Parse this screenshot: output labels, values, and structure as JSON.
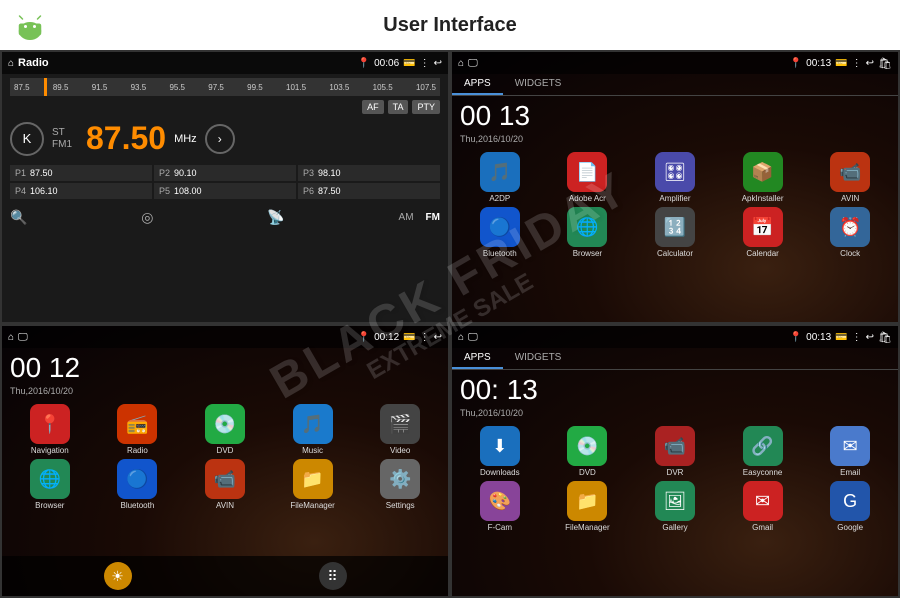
{
  "header": {
    "title": "User Interface"
  },
  "watermark": {
    "line1": "BLACK FRIDAY",
    "line2": "EXTREME SALE"
  },
  "screen1": {
    "title": "Radio",
    "status": {
      "time": "00:06",
      "icon_home": "⌂",
      "icon_map": "📍"
    },
    "freq_markers": [
      "87.5",
      "89.5",
      "91.5",
      "93.5",
      "95.5",
      "97.5",
      "99.5",
      "101.5",
      "103.5",
      "105.5",
      "107.5"
    ],
    "buttons": [
      "AF",
      "TA",
      "PTY"
    ],
    "band": "ST FM1",
    "frequency": "87.50",
    "unit": "MHz",
    "presets": [
      {
        "label": "P1",
        "freq": "87.50"
      },
      {
        "label": "P2",
        "freq": "90.10"
      },
      {
        "label": "P3",
        "freq": "98.10"
      },
      {
        "label": "P4",
        "freq": "106.10"
      },
      {
        "label": "P5",
        "freq": "108.00"
      },
      {
        "label": "P6",
        "freq": "87.50"
      }
    ],
    "mode_am": "AM",
    "mode_fm": "FM"
  },
  "screen2": {
    "status": {
      "time": "00:13"
    },
    "tabs": [
      "APPS",
      "WIDGETS"
    ],
    "active_tab": "APPS",
    "clock": "00 13",
    "date": "Thu,2016/10/20",
    "apps": [
      {
        "name": "A2DP",
        "color": "#1a6fbd",
        "icon": "🎵"
      },
      {
        "name": "Adobe Acr",
        "color": "#cc2222",
        "icon": "📄"
      },
      {
        "name": "Amplifier",
        "color": "#4a4aaa",
        "icon": "🎛"
      },
      {
        "name": "ApkInstaller",
        "color": "#228822",
        "icon": "📦"
      },
      {
        "name": "AVIN",
        "color": "#bb3311",
        "icon": "📹"
      },
      {
        "name": "Bluetooth",
        "color": "#1155cc",
        "icon": "🔵"
      },
      {
        "name": "Browser",
        "color": "#228855",
        "icon": "🌐"
      },
      {
        "name": "Calculator",
        "color": "#444444",
        "icon": "🔢"
      },
      {
        "name": "Calendar",
        "color": "#cc2222",
        "icon": "📅"
      },
      {
        "name": "Clock",
        "color": "#336699",
        "icon": "⏰"
      }
    ]
  },
  "screen3": {
    "status": {
      "time": "00:12"
    },
    "clock": "00 12",
    "date": "Thu,2016/10/20",
    "apps": [
      {
        "name": "Navigation",
        "color": "#cc2222",
        "icon": "📍"
      },
      {
        "name": "Radio",
        "color": "#cc3300",
        "icon": "📻"
      },
      {
        "name": "DVD",
        "color": "#22aa44",
        "icon": "💿"
      },
      {
        "name": "Music",
        "color": "#1a7acc",
        "icon": "🎵"
      },
      {
        "name": "Video",
        "color": "#444",
        "icon": "🎬"
      },
      {
        "name": "Browser",
        "color": "#228855",
        "icon": "🌐"
      },
      {
        "name": "Bluetooth",
        "color": "#1155cc",
        "icon": "🔵"
      },
      {
        "name": "AVIN",
        "color": "#bb3311",
        "icon": "📹"
      },
      {
        "name": "FileManager",
        "color": "#cc8800",
        "icon": "📁"
      },
      {
        "name": "Settings",
        "color": "#666",
        "icon": "⚙️"
      }
    ],
    "bottom": [
      {
        "name": "sun-icon",
        "icon": "☀️",
        "color": "#cc8800"
      },
      {
        "name": "apps-icon",
        "icon": "⠿",
        "color": "#444"
      }
    ]
  },
  "screen4": {
    "status": {
      "time": "00:13"
    },
    "tabs": [
      "APPS",
      "WIDGETS"
    ],
    "active_tab": "APPS",
    "clock": "00: 13",
    "date": "Thu,2016/10/20",
    "apps": [
      {
        "name": "Downloads",
        "color": "#1a6fbd",
        "icon": "⬇️"
      },
      {
        "name": "DVD",
        "color": "#22aa44",
        "icon": "💿"
      },
      {
        "name": "DVR",
        "color": "#aa2222",
        "icon": "📹"
      },
      {
        "name": "Easyconne",
        "color": "#228855",
        "icon": "🔗"
      },
      {
        "name": "Email",
        "color": "#4a7acc",
        "icon": "✉️"
      },
      {
        "name": "F-Cam",
        "color": "#884499",
        "icon": "🎨"
      },
      {
        "name": "FileManager",
        "color": "#cc8800",
        "icon": "📁"
      },
      {
        "name": "Gallery",
        "color": "#228855",
        "icon": "🖼️"
      },
      {
        "name": "Gmail",
        "color": "#cc2222",
        "icon": "✉️"
      },
      {
        "name": "Google",
        "color": "#2255aa",
        "icon": "G"
      }
    ]
  }
}
